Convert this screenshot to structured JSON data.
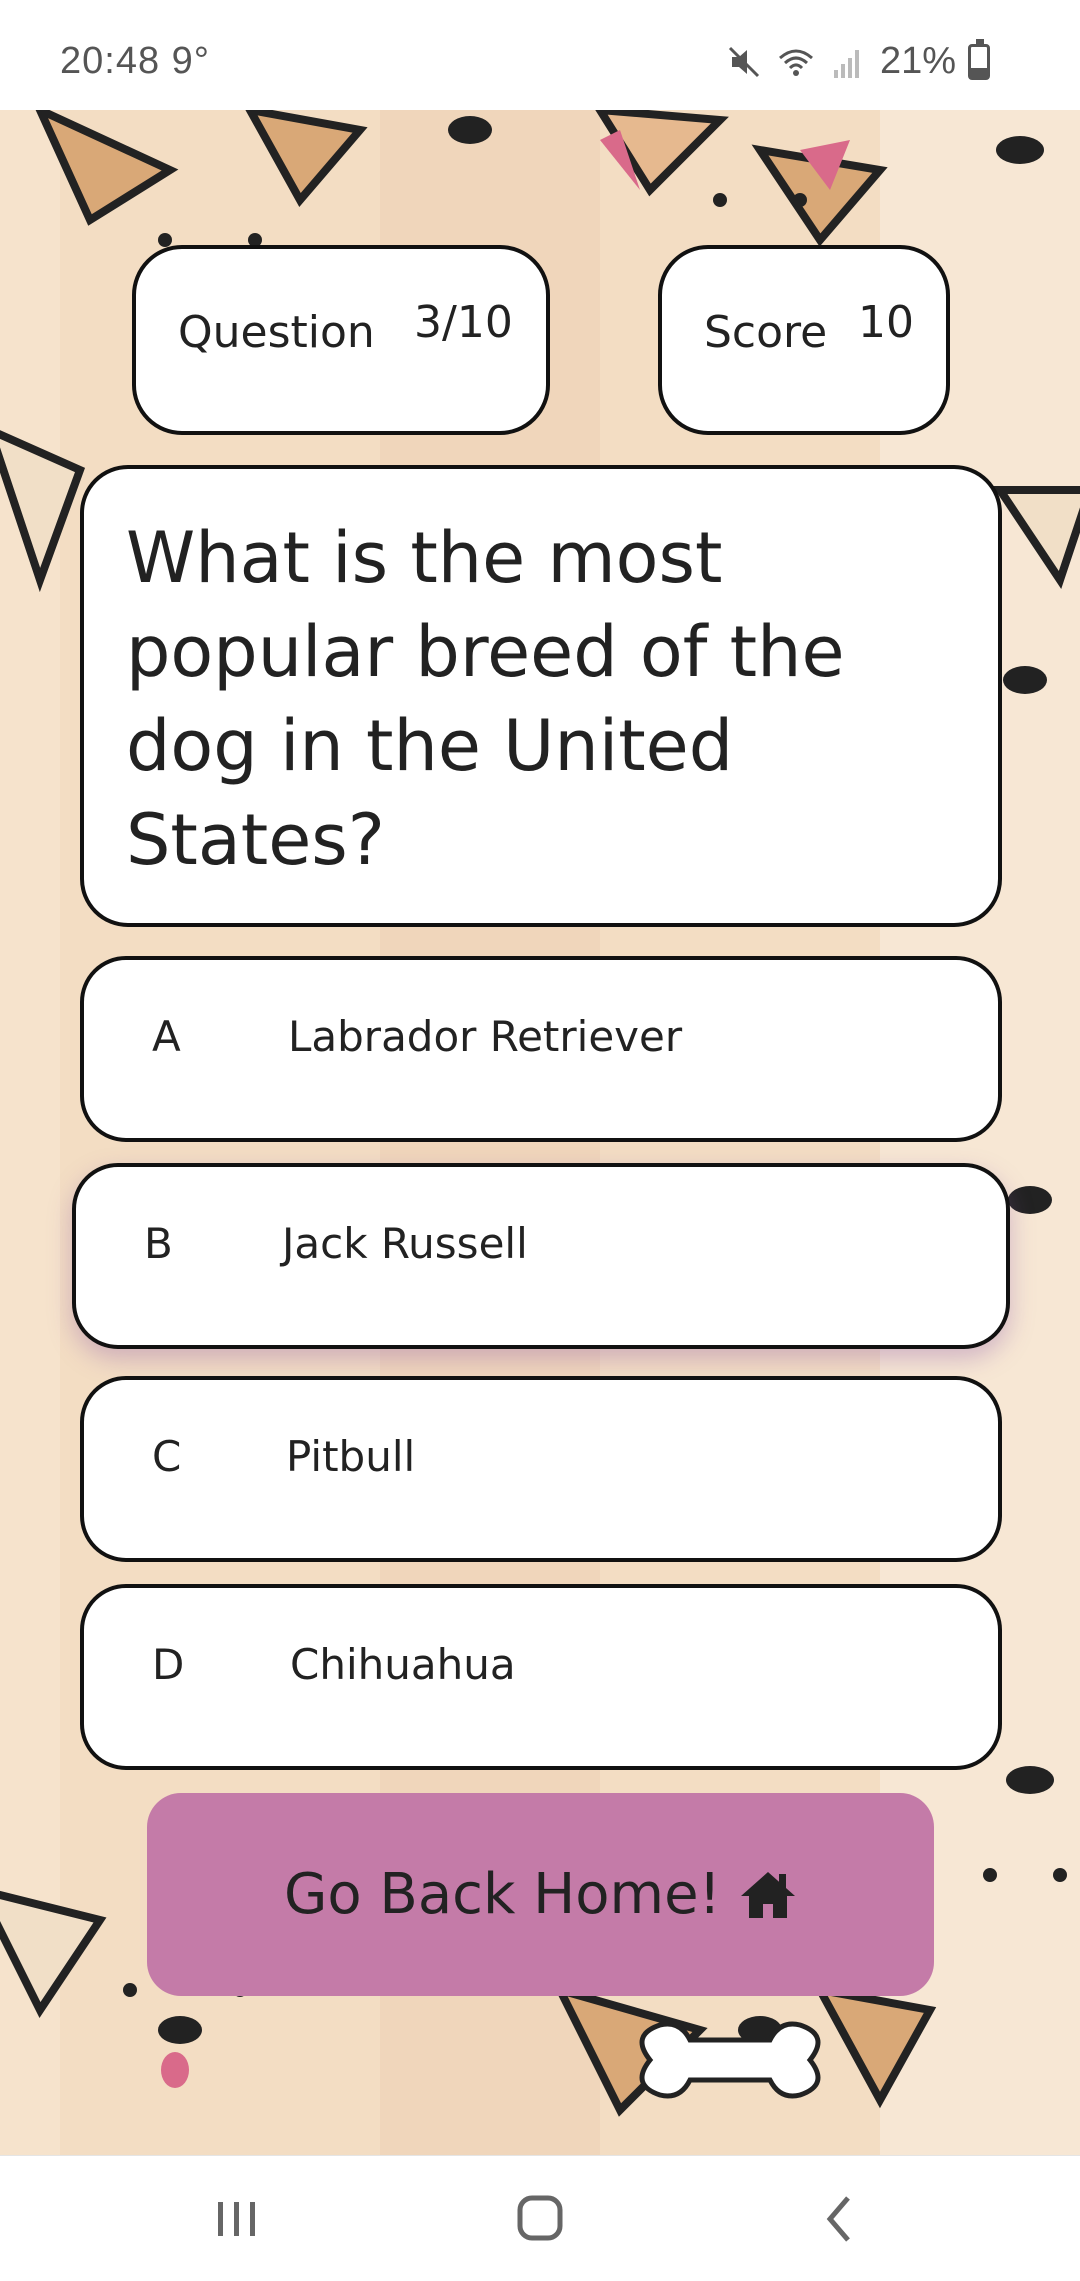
{
  "status_bar": {
    "time": "20:48",
    "temperature": "9°",
    "battery": "21%",
    "icons": [
      "mute-icon",
      "wifi-icon",
      "signal-icon",
      "battery-icon"
    ]
  },
  "header": {
    "question_label": "Question",
    "question_value": "3/10",
    "score_label": "Score",
    "score_value": "10"
  },
  "question": {
    "text": "What is the most popular breed of the dog in the United States?"
  },
  "answers": [
    {
      "letter": "A",
      "text": "Labrador Retriever"
    },
    {
      "letter": "B",
      "text": "Jack Russell"
    },
    {
      "letter": "C",
      "text": "Pitbull"
    },
    {
      "letter": "D",
      "text": "Chihuahua"
    }
  ],
  "home_button": {
    "label": "Go Back Home!",
    "icon": "home-icon"
  },
  "colors": {
    "accent": "#c47ba8",
    "background": "#f3ddc3",
    "card": "#ffffff",
    "border": "#111111"
  },
  "nav_bar": {
    "items": [
      "recent-apps-icon",
      "home-nav-icon",
      "back-icon"
    ]
  }
}
